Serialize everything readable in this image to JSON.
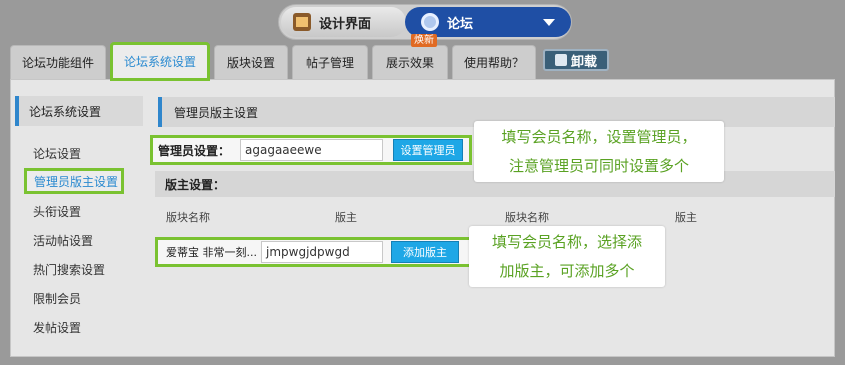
{
  "switcher": {
    "design_label": "设计界面",
    "forum_label": "论坛"
  },
  "tabs": [
    {
      "label": "论坛功能组件"
    },
    {
      "label": "论坛系统设置"
    },
    {
      "label": "版块设置"
    },
    {
      "label": "帖子管理"
    },
    {
      "label": "展示效果",
      "badge": "焕新"
    },
    {
      "label": "使用帮助？"
    }
  ],
  "uninstall_label": "卸载",
  "sidebar": {
    "title": "论坛系统设置",
    "items": [
      {
        "label": "论坛设置"
      },
      {
        "label": "管理员版主设置"
      },
      {
        "label": "头衔设置"
      },
      {
        "label": "活动帖设置"
      },
      {
        "label": "热门搜索设置"
      },
      {
        "label": "限制会员"
      },
      {
        "label": "发帖设置"
      }
    ]
  },
  "main": {
    "title": "管理员版主设置",
    "admin": {
      "label": "管理员设置：",
      "value": "agagaaeewe",
      "button": "设置管理员"
    },
    "moderator": {
      "label": "版主设置：",
      "headers": [
        "版块名称",
        "版主",
        "版块名称",
        "版主"
      ],
      "row": {
        "forum": "爱蒂宝 非常一刻...",
        "value": "jmpwgjdpwgd",
        "button": "添加版主"
      }
    }
  },
  "tips": {
    "tip1_line1": "填写会员名称，设置管理员，",
    "tip1_line2": "注意管理员可同时设置多个",
    "tip2_line1": "填写会员名称，选择添",
    "tip2_line2": "加版主，可添加多个"
  },
  "colors": {
    "highlight": "#7ac231",
    "accent_blue": "#2f86cc",
    "button_blue": "#1ea7e6",
    "tip_text": "#5aa223"
  }
}
